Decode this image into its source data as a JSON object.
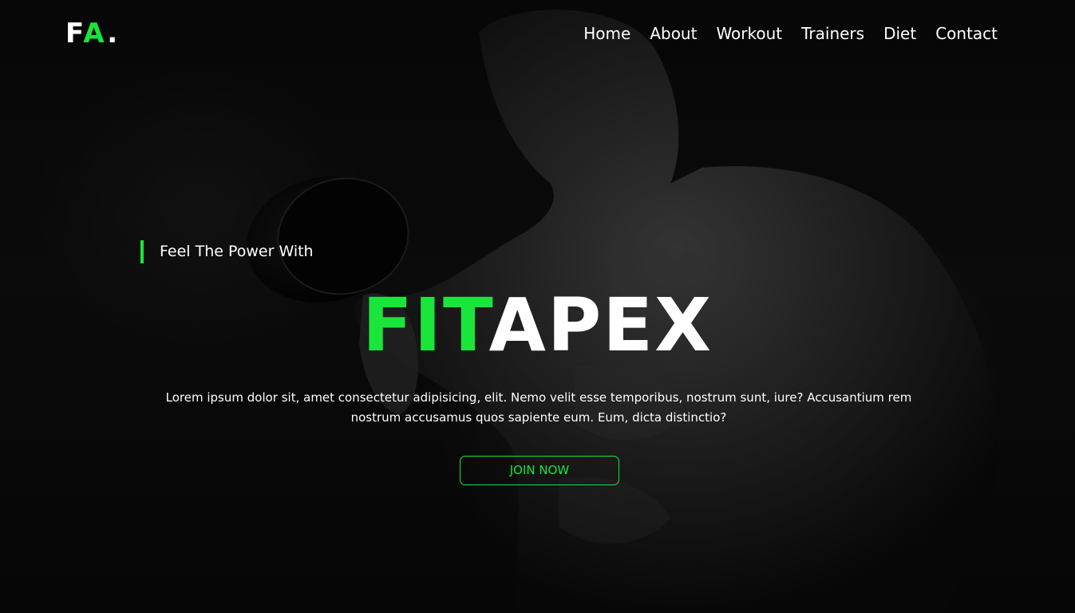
{
  "brand": {
    "logo_main": "F",
    "logo_accent": "A",
    "logo_dot": ".",
    "accent_color": "#19e53b"
  },
  "nav": {
    "items": [
      {
        "label": "Home"
      },
      {
        "label": "About"
      },
      {
        "label": "Workout"
      },
      {
        "label": "Trainers"
      },
      {
        "label": "Diet"
      },
      {
        "label": "Contact"
      }
    ]
  },
  "hero": {
    "tagline": "Feel The Power With",
    "title_accent": "FIT",
    "title_main": "APEX",
    "description": "Lorem ipsum dolor sit, amet consectetur adipisicing, elit. Nemo velit esse temporibus, nostrum sunt, iure? Accusantium rem nostrum accusamus quos sapiente eum. Eum, dicta distinctio?",
    "cta_label": "JOIN NOW",
    "background_image": "bodybuilder-lifting-dumbbell-photo"
  }
}
